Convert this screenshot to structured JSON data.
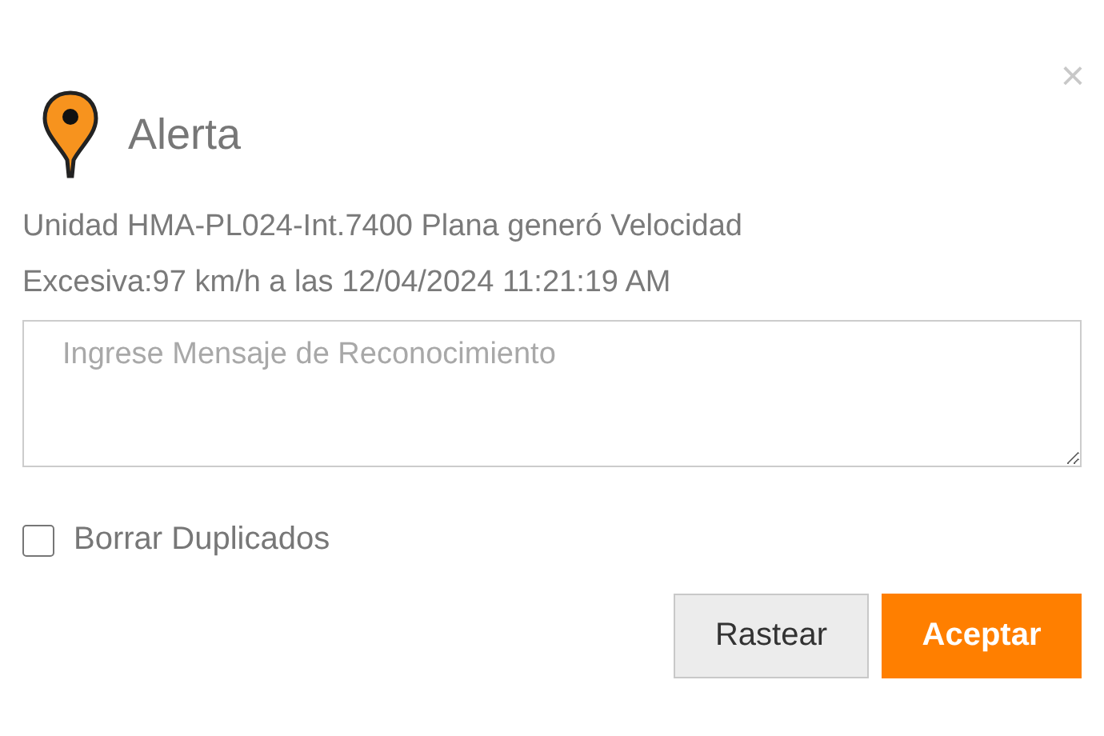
{
  "dialog": {
    "close": "×",
    "title": "Alerta",
    "message": "Unidad HMA-PL024-Int.7400 Plana generó Velocidad Excesiva:97 km/h a las 12/04/2024 11:21:19 AM",
    "input": {
      "placeholder": "Ingrese Mensaje de Reconocimiento"
    },
    "checkbox": {
      "label": "Borrar Duplicados",
      "checked": false
    },
    "buttons": [
      {
        "label": "Rastear",
        "kind": "secondary"
      },
      {
        "label": "Aceptar",
        "kind": "primary"
      }
    ]
  }
}
